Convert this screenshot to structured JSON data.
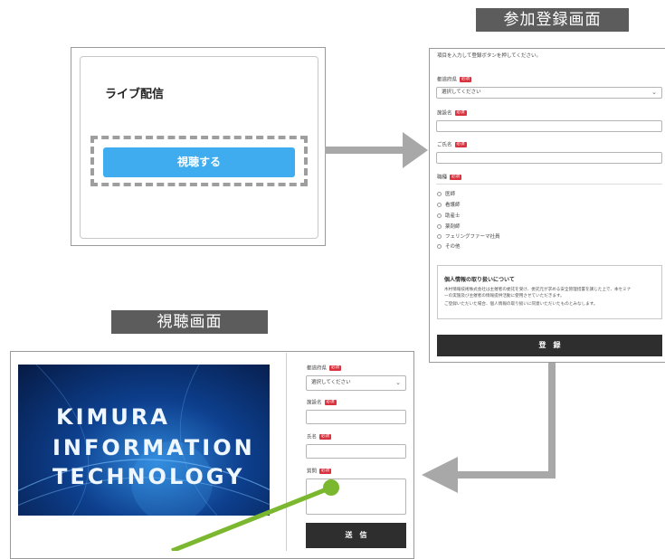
{
  "sections": {
    "registration_title": "参加登録画面",
    "watch_title": "視聴画面"
  },
  "live": {
    "title": "ライブ配信",
    "button_label": "視聴する"
  },
  "registration": {
    "intro": "項目を入力して登録ボタンを押してください。",
    "prefecture_label": "都道府県",
    "required_badge": "必須",
    "prefecture_placeholder": "選択してください",
    "facility_label": "施設名",
    "name_label": "ご氏名",
    "occupation_label": "職種",
    "occupations": [
      "医師",
      "看護師",
      "助産士",
      "薬剤師",
      "フェリングファーマ社員",
      "その他"
    ],
    "privacy_title": "個人情報の取り扱いについて",
    "privacy_text_1": "木村情報技術株式会社は主催者の委託を受け、委託元が求める安全管理措置を講じた上で、本セミナ",
    "privacy_text_2": "ーの実施及び主催者の情報提供活動に使用させていただきます。",
    "privacy_text_3": "ご登録いただいた場合、個人情報の取り扱いに同意いただいたものとみなします。",
    "submit_label": "登　録"
  },
  "watch": {
    "video_lines": [
      "KIMURA",
      "INFORMATION",
      "TECHNOLOGY"
    ],
    "prefecture_label": "都道府県",
    "required_badge": "必須",
    "prefecture_placeholder": "選択してください",
    "facility_label": "施設名",
    "name_label": "氏名",
    "question_label": "質問",
    "send_label": "送　信"
  },
  "colors": {
    "accent_blue": "#3eacef",
    "required_red": "#d9333f",
    "arrow_gray": "#a8a8a8",
    "annotation_green": "#7cb82f",
    "dark_button": "#2e2e2e"
  }
}
